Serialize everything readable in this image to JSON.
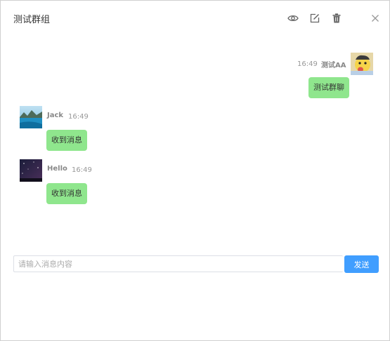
{
  "dialog": {
    "title": "测试群组",
    "icons": [
      "eye-icon",
      "edit-icon",
      "trash-icon",
      "close-icon"
    ]
  },
  "messages": [
    {
      "sender": "测试AA",
      "time": "16:49",
      "text": "测试群聊",
      "side": "right",
      "avatar": "cartoon-avatar"
    },
    {
      "sender": "Jack",
      "time": "16:49",
      "text": "收到消息",
      "side": "left",
      "avatar": "lake-avatar"
    },
    {
      "sender": "Hello",
      "time": "16:49",
      "text": "收到消息",
      "side": "left",
      "avatar": "starry-sky-avatar"
    }
  ],
  "composer": {
    "placeholder": "请输入消息内容",
    "value": "",
    "send_label": "发送"
  },
  "colors": {
    "bubble": "#8fe68d",
    "send_button": "#409eff",
    "border": "#cfcfcf"
  }
}
